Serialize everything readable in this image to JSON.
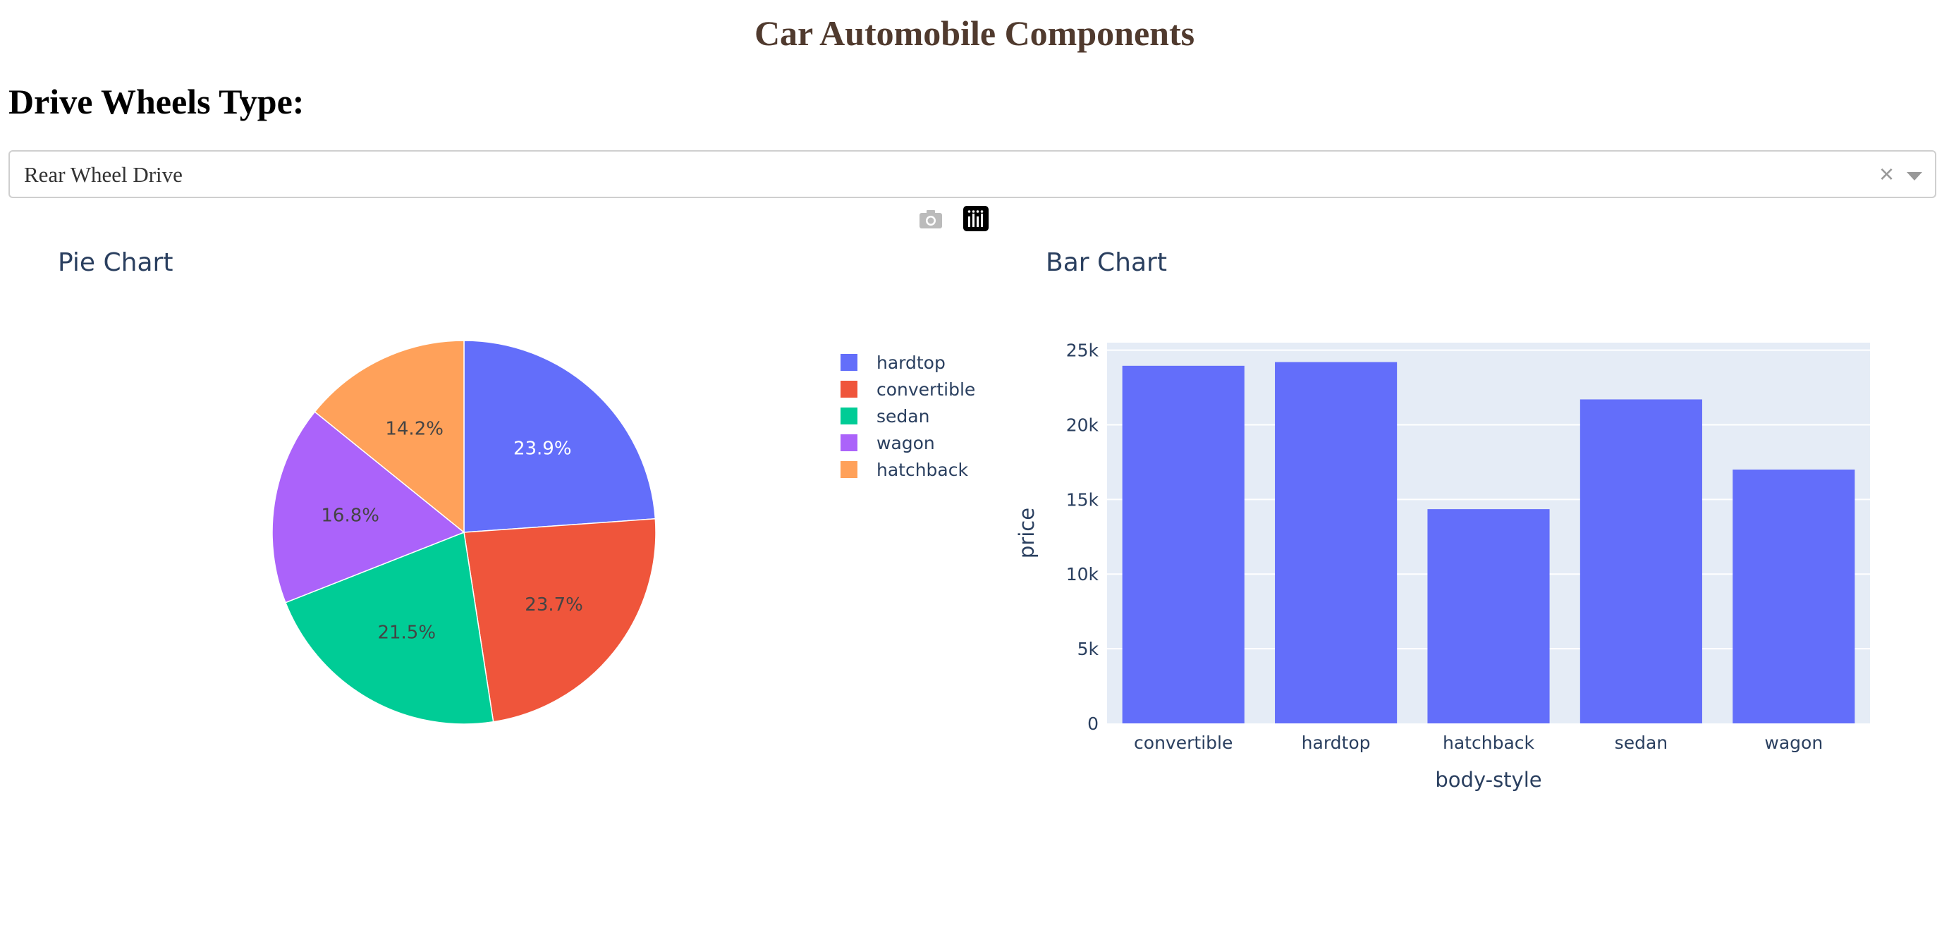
{
  "header": {
    "title": "Car Automobile Components"
  },
  "filter": {
    "label": "Drive Wheels Type:",
    "selected": "Rear Wheel Drive",
    "clear_glyph": "×"
  },
  "modebar": {
    "icons": [
      "camera-icon",
      "plotly-logo-icon"
    ]
  },
  "colors": {
    "plotly_blue": "#636efa",
    "plotly_red": "#EF553B",
    "plotly_green": "#00cc96",
    "plotly_purple": "#ab63fa",
    "plotly_orange": "#FFA15A",
    "plot_bg": "#E5ECF6",
    "title_text": "#503A2E",
    "axis_text": "#2a3f5f"
  },
  "chart_data": [
    {
      "type": "pie",
      "title": "Pie Chart",
      "slices": [
        {
          "label": "hardtop",
          "percent": 23.9,
          "color": "#636efa"
        },
        {
          "label": "convertible",
          "percent": 23.7,
          "color": "#EF553B"
        },
        {
          "label": "sedan",
          "percent": 21.5,
          "color": "#00cc96"
        },
        {
          "label": "wagon",
          "percent": 16.8,
          "color": "#ab63fa"
        },
        {
          "label": "hatchback",
          "percent": 14.2,
          "color": "#FFA15A"
        }
      ],
      "legend_position": "right"
    },
    {
      "type": "bar",
      "title": "Bar Chart",
      "categories": [
        "convertible",
        "hardtop",
        "hatchback",
        "sedan",
        "wagon"
      ],
      "values": [
        23950,
        24200,
        14350,
        21700,
        17000
      ],
      "xlabel": "body-style",
      "ylabel": "price",
      "ylim": [
        0,
        25500
      ],
      "yticks": [
        0,
        5000,
        10000,
        15000,
        20000,
        25000
      ],
      "ytick_labels": [
        "0",
        "5k",
        "10k",
        "15k",
        "20k",
        "25k"
      ],
      "grid": true,
      "bar_color": "#636efa"
    }
  ]
}
